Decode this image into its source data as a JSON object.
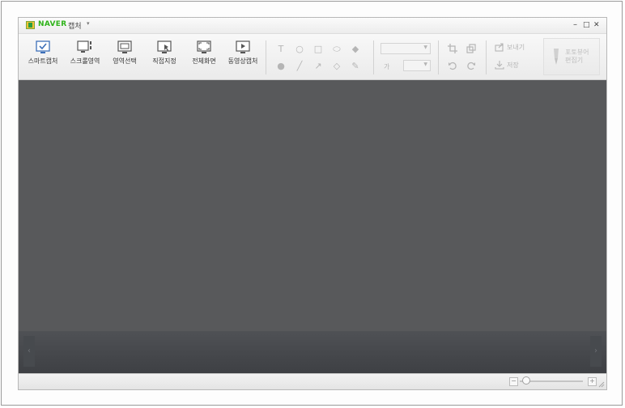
{
  "window": {
    "brand": "NAVER",
    "app_name": "캡처",
    "app_menu_arrow": "▾",
    "controls": {
      "minimize": "–",
      "maximize": "□",
      "close": "✕"
    }
  },
  "toolbar": {
    "capture_tools": [
      {
        "label": "스마트캡처",
        "icon": "smart-capture-icon"
      },
      {
        "label": "스크롤영역",
        "icon": "scroll-capture-icon"
      },
      {
        "label": "영역선택",
        "icon": "region-select-icon"
      },
      {
        "label": "직접지정",
        "icon": "manual-select-icon"
      },
      {
        "label": "전체화면",
        "icon": "fullscreen-icon"
      },
      {
        "label": "동영상캡처",
        "icon": "video-capture-icon"
      }
    ],
    "draw_tools": {
      "text_icon": "T",
      "ellipse_icon": "○",
      "rect_icon": "□",
      "rounded_rect_icon": "⬭",
      "fill_icon": "◆",
      "stamp_icon": "●",
      "line_icon": "╱",
      "arrow_icon": "↗",
      "eraser_icon": "◇",
      "pen_icon": "✎"
    },
    "font_size_prefix": "가",
    "send_label": "보내기",
    "save_label": "저장",
    "photo_editor_label_1": "포토뷰어",
    "photo_editor_label_2": "편집기"
  },
  "filmstrip": {
    "prev": "‹",
    "next": "›"
  },
  "statusbar": {
    "zoom_out": "−",
    "zoom_in": "+",
    "zoom_level": 0.05
  },
  "colors": {
    "canvas": "#58595b",
    "filmstrip": "#43454a",
    "brand_green": "#2fb31a",
    "icon_blue": "#3d6fb8"
  }
}
